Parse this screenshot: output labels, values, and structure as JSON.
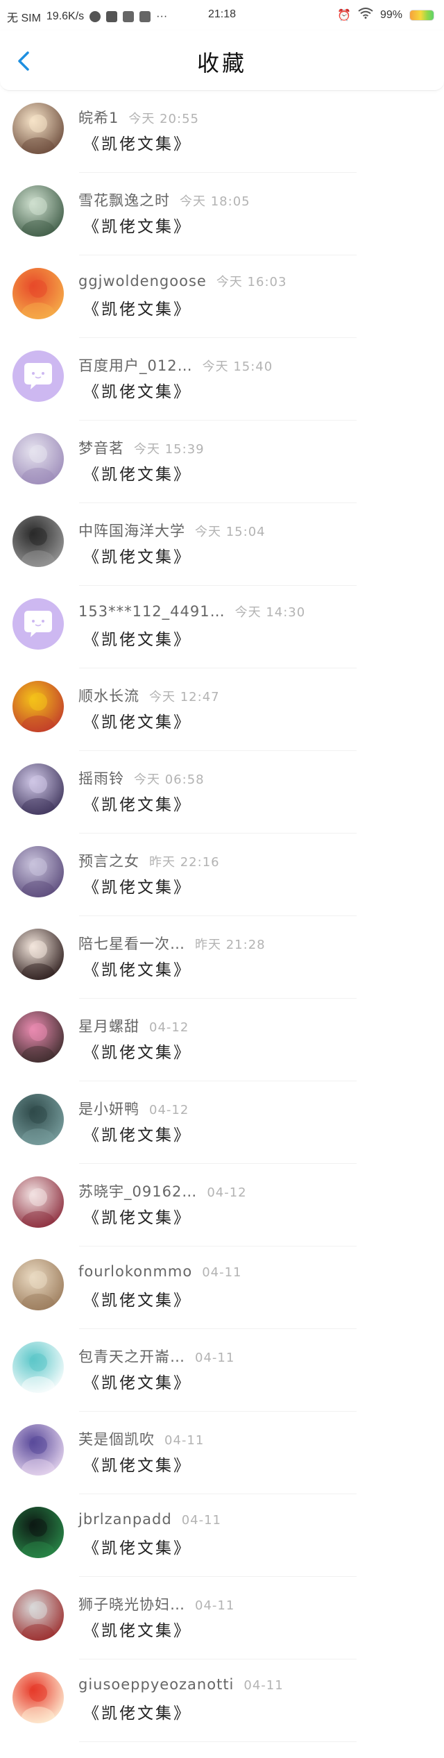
{
  "status_bar": {
    "carrier": "无 SIM",
    "speed": "19.6K/s",
    "time": "21:18",
    "battery": "99%"
  },
  "header": {
    "title": "收藏",
    "back_icon": "chevron-left-icon"
  },
  "colors": {
    "accent": "#1e8fe0",
    "name": "#666666",
    "time": "#b3b3b3"
  },
  "items": [
    {
      "name": "皖希1",
      "time": "今天 20:55",
      "title": "《凯佬文集》",
      "avatar": "anime-girl-with-glasses",
      "avatar_colors": [
        "#f6e3c8",
        "#6a4a3a"
      ]
    },
    {
      "name": "雪花飘逸之时",
      "time": "今天 18:05",
      "title": "《凯佬文集》",
      "avatar": "ink-landscape-painting",
      "avatar_colors": [
        "#cfe0cf",
        "#3d5a45"
      ]
    },
    {
      "name": "ggjwoldengoose",
      "time": "今天 16:03",
      "title": "《凯佬文集》",
      "avatar": "red-cartoon-fruit",
      "avatar_colors": [
        "#e74a2a",
        "#f6b04a"
      ]
    },
    {
      "name": "百度用户_012…",
      "time": "今天 15:40",
      "title": "《凯佬文集》",
      "avatar": "default-chat-bubble",
      "avatar_colors": [
        "#cdb8f1",
        "#ffffff"
      ]
    },
    {
      "name": "梦音茗",
      "time": "今天 15:39",
      "title": "《凯佬文集》",
      "avatar": "white-hair-anime-girl",
      "avatar_colors": [
        "#e6e3ef",
        "#9b8ab8"
      ]
    },
    {
      "name": "中阵国海洋大学",
      "time": "今天 15:04",
      "title": "《凯佬文集》",
      "avatar": "black-white-photo",
      "avatar_colors": [
        "#2a2a2a",
        "#9a9a9a"
      ]
    },
    {
      "name": "153***112_4491…",
      "time": "今天 14:30",
      "title": "《凯佬文集》",
      "avatar": "default-chat-bubble",
      "avatar_colors": [
        "#cdb8f1",
        "#ffffff"
      ]
    },
    {
      "name": "顺水长流",
      "time": "今天 12:47",
      "title": "《凯佬文集》",
      "avatar": "yellow-sailboat",
      "avatar_colors": [
        "#f4c21a",
        "#c0392b"
      ]
    },
    {
      "name": "摇雨铃",
      "time": "今天 06:58",
      "title": "《凯佬文集》",
      "avatar": "anime-girl-purple",
      "avatar_colors": [
        "#cfc7e6",
        "#3d335a"
      ]
    },
    {
      "name": "预言之女",
      "time": "昨天 22:16",
      "title": "《凯佬文集》",
      "avatar": "anime-girl-silver",
      "avatar_colors": [
        "#c9c3dc",
        "#5a4a7a"
      ]
    },
    {
      "name": "陪七星看一次…",
      "time": "昨天 21:28",
      "title": "《凯佬文集》",
      "avatar": "anime-girl-dark-hair",
      "avatar_colors": [
        "#f3e6dc",
        "#2a1a1a"
      ]
    },
    {
      "name": "星月螺甜",
      "time": "04-12",
      "title": "《凯佬文集》",
      "avatar": "pink-anime-girl",
      "avatar_colors": [
        "#e98bb0",
        "#3a2a2a"
      ]
    },
    {
      "name": "是小妍鸭",
      "time": "04-12",
      "title": "《凯佬文集》",
      "avatar": "dark-teal-photo",
      "avatar_colors": [
        "#2f4a4a",
        "#7aa0a0"
      ]
    },
    {
      "name": "苏晓宇_09162…",
      "time": "04-12",
      "title": "《凯佬文集》",
      "avatar": "person-photo",
      "avatar_colors": [
        "#f2e2e2",
        "#8a2a3a"
      ]
    },
    {
      "name": "fourlokonmmo",
      "time": "04-11",
      "title": "《凯佬文集》",
      "avatar": "beige-room-photo",
      "avatar_colors": [
        "#eadac2",
        "#9a7a5a"
      ]
    },
    {
      "name": "包青天之开崙…",
      "time": "04-11",
      "title": "《凯佬文集》",
      "avatar": "teal-cartoon-ghost",
      "avatar_colors": [
        "#5cc7c9",
        "#ffffff"
      ]
    },
    {
      "name": "芙是個凯吹",
      "time": "04-11",
      "title": "《凯佬文集》",
      "avatar": "purple-hair-anime-girl",
      "avatar_colors": [
        "#5a4a9a",
        "#e8d8f0"
      ]
    },
    {
      "name": "jbrlzanpadd",
      "time": "04-11",
      "title": "《凯佬文集》",
      "avatar": "dark-green-night",
      "avatar_colors": [
        "#0d1a14",
        "#2a8a4a"
      ]
    },
    {
      "name": "狮子晓光协妇…",
      "time": "04-11",
      "title": "《凯佬文集》",
      "avatar": "red-car-photo",
      "avatar_colors": [
        "#d9d9d9",
        "#9a2a2a"
      ]
    },
    {
      "name": "giusoeppyeozanotti",
      "time": "04-11",
      "title": "《凯佬文集》",
      "avatar": "red-cap-cartoon",
      "avatar_colors": [
        "#e63a2a",
        "#fff2d8"
      ]
    }
  ]
}
